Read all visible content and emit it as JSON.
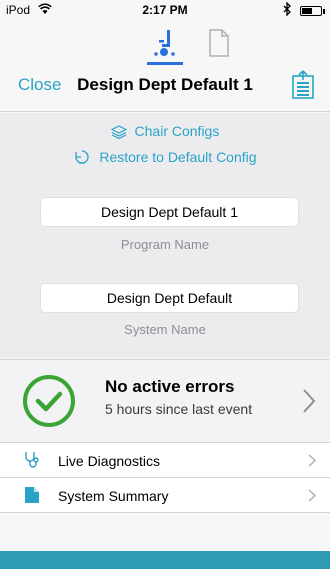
{
  "status_bar": {
    "carrier": "iPod",
    "time": "2:17 PM",
    "battery_level": 0.55
  },
  "header": {
    "tabs": [
      {
        "name": "chair",
        "icon": "wheelchair-icon",
        "selected": true
      },
      {
        "name": "document",
        "icon": "document-icon",
        "selected": false
      }
    ],
    "close_label": "Close",
    "title": "Design Dept Default 1",
    "export_icon": "export-document-icon"
  },
  "config": {
    "chair_configs_label": "Chair Configs",
    "restore_label": "Restore to Default Config",
    "program_name_value": "Design Dept Default 1",
    "program_name_label": "Program Name",
    "system_name_value": "Design Dept Default",
    "system_name_label": "System Name"
  },
  "status": {
    "title": "No active errors",
    "subtitle": "5 hours since last event",
    "icon": "check-circle-icon"
  },
  "list": [
    {
      "label": "Live Diagnostics",
      "icon": "stethoscope-icon"
    },
    {
      "label": "System Summary",
      "icon": "document-icon"
    }
  ],
  "colors": {
    "accent": "#2aa3c6",
    "tab_selected": "#2a6fdb",
    "success": "#3aa535",
    "bottom_bar": "#2e9ab4"
  }
}
